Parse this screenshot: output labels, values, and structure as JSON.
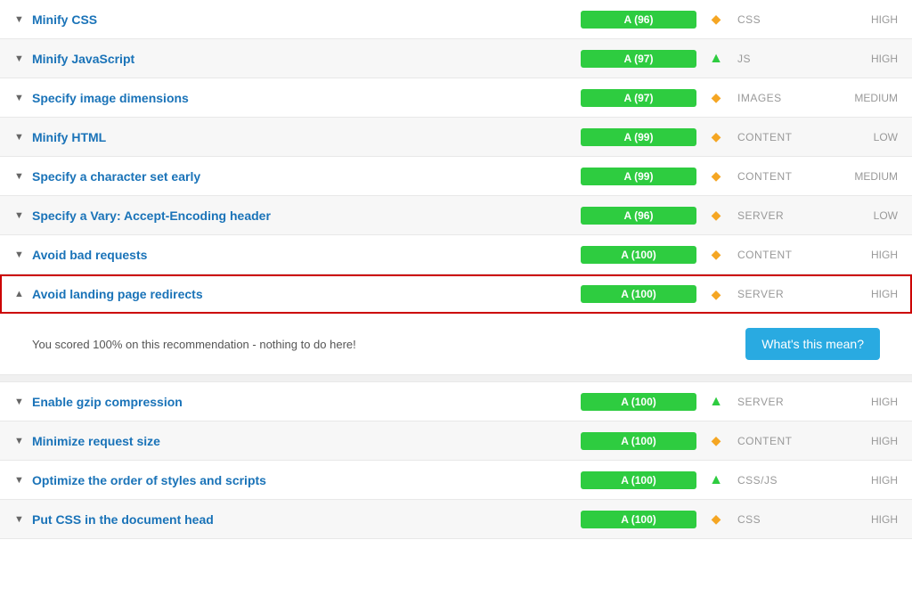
{
  "rows": [
    {
      "id": "minify-css",
      "title": "Minify CSS",
      "score": "A (96)",
      "trend": "diamond",
      "category": "CSS",
      "priority": "HIGH",
      "expanded": false,
      "highlighted": false
    },
    {
      "id": "minify-js",
      "title": "Minify JavaScript",
      "score": "A (97)",
      "trend": "up",
      "category": "JS",
      "priority": "HIGH",
      "expanded": false,
      "highlighted": false
    },
    {
      "id": "specify-image-dimensions",
      "title": "Specify image dimensions",
      "score": "A (97)",
      "trend": "diamond",
      "category": "IMAGES",
      "priority": "MEDIUM",
      "expanded": false,
      "highlighted": false
    },
    {
      "id": "minify-html",
      "title": "Minify HTML",
      "score": "A (99)",
      "trend": "diamond",
      "category": "CONTENT",
      "priority": "LOW",
      "expanded": false,
      "highlighted": false
    },
    {
      "id": "specify-charset",
      "title": "Specify a character set early",
      "score": "A (99)",
      "trend": "diamond",
      "category": "CONTENT",
      "priority": "MEDIUM",
      "expanded": false,
      "highlighted": false
    },
    {
      "id": "specify-vary",
      "title": "Specify a Vary: Accept-Encoding header",
      "score": "A (96)",
      "trend": "diamond",
      "category": "SERVER",
      "priority": "LOW",
      "expanded": false,
      "highlighted": false
    },
    {
      "id": "avoid-bad-requests",
      "title": "Avoid bad requests",
      "score": "A (100)",
      "trend": "diamond",
      "category": "CONTENT",
      "priority": "HIGH",
      "expanded": false,
      "highlighted": false
    },
    {
      "id": "avoid-landing-redirects",
      "title": "Avoid landing page redirects",
      "score": "A (100)",
      "trend": "diamond",
      "category": "SERVER",
      "priority": "HIGH",
      "expanded": true,
      "highlighted": true,
      "expandedText": "You scored 100% on this recommendation - nothing to do here!",
      "whatsThisMean": "What's this mean?"
    }
  ],
  "rows2": [
    {
      "id": "enable-gzip",
      "title": "Enable gzip compression",
      "score": "A (100)",
      "trend": "up",
      "category": "SERVER",
      "priority": "HIGH",
      "expanded": false,
      "highlighted": false
    },
    {
      "id": "minimize-request-size",
      "title": "Minimize request size",
      "score": "A (100)",
      "trend": "diamond",
      "category": "CONTENT",
      "priority": "HIGH",
      "expanded": false,
      "highlighted": false
    },
    {
      "id": "optimize-order-styles",
      "title": "Optimize the order of styles and scripts",
      "score": "A (100)",
      "trend": "up",
      "category": "CSS/JS",
      "priority": "HIGH",
      "expanded": false,
      "highlighted": false
    },
    {
      "id": "put-css-head",
      "title": "Put CSS in the document head",
      "score": "A (100)",
      "trend": "diamond",
      "category": "CSS",
      "priority": "HIGH",
      "expanded": false,
      "highlighted": false
    }
  ]
}
